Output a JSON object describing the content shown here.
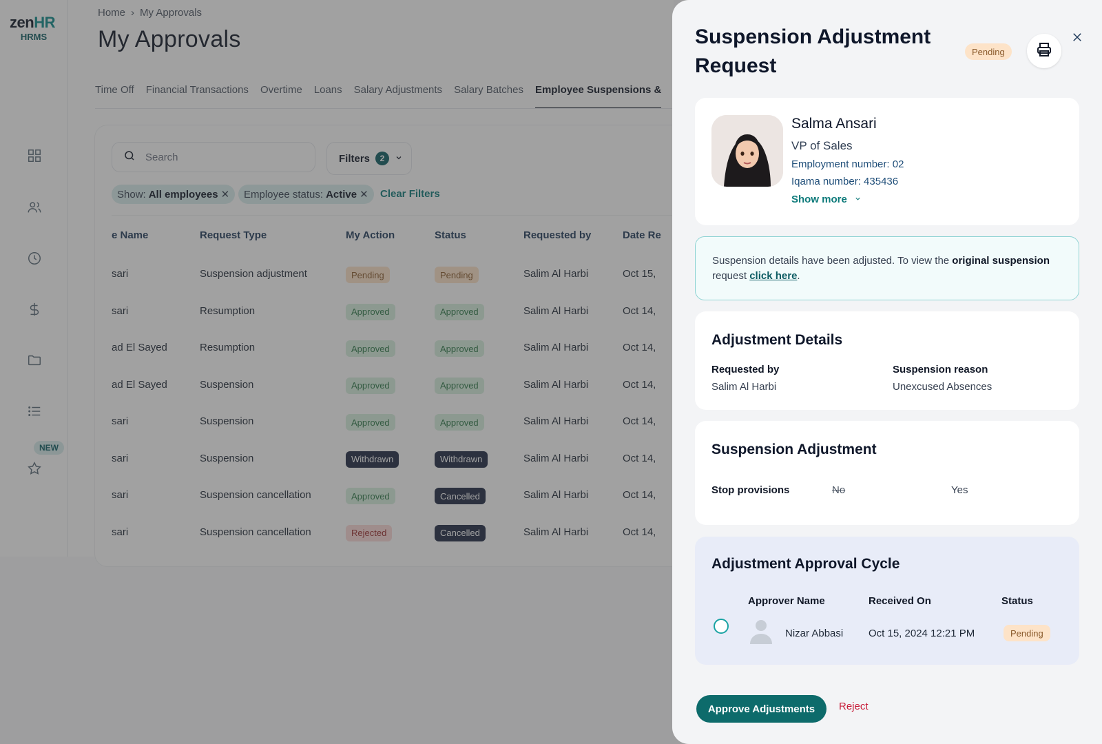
{
  "app": {
    "logo_main": "zen",
    "logo_accent": "HR",
    "logo_sub": "HRMS",
    "new_badge": "NEW"
  },
  "breadcrumb": {
    "home": "Home",
    "current": "My Approvals"
  },
  "page": {
    "title": "My Approvals"
  },
  "tabs": [
    "Time Off",
    "Financial Transactions",
    "Overtime",
    "Loans",
    "Salary Adjustments",
    "Salary Batches",
    "Employee Suspensions &"
  ],
  "active_tab_index": 6,
  "search": {
    "placeholder": "Search"
  },
  "filters": {
    "label": "Filters",
    "count": "2"
  },
  "chips": [
    {
      "prefix": "Show:",
      "value": "All employees"
    },
    {
      "prefix": "Employee status:",
      "value": "Active"
    }
  ],
  "clear_filters": "Clear Filters",
  "table": {
    "headers": [
      "e Name",
      "Request Type",
      "My Action",
      "Status",
      "Requested by",
      "Date Re"
    ],
    "rows": [
      {
        "name": "sari",
        "type": "Suspension adjustment",
        "action": "Pending",
        "action_kind": "pending",
        "status": "Pending",
        "status_kind": "pending",
        "by": "Salim Al Harbi",
        "date": "Oct 15,"
      },
      {
        "name": "sari",
        "type": "Resumption",
        "action": "Approved",
        "action_kind": "approved",
        "status": "Approved",
        "status_kind": "approved",
        "by": "Salim Al Harbi",
        "date": "Oct 14,"
      },
      {
        "name": "ad El Sayed",
        "type": "Resumption",
        "action": "Approved",
        "action_kind": "approved",
        "status": "Approved",
        "status_kind": "approved",
        "by": "Salim Al Harbi",
        "date": "Oct 14,"
      },
      {
        "name": "ad El Sayed",
        "type": "Suspension",
        "action": "Approved",
        "action_kind": "approved",
        "status": "Approved",
        "status_kind": "approved",
        "by": "Salim Al Harbi",
        "date": "Oct 14,"
      },
      {
        "name": "sari",
        "type": "Suspension",
        "action": "Approved",
        "action_kind": "approved",
        "status": "Approved",
        "status_kind": "approved",
        "by": "Salim Al Harbi",
        "date": "Oct 14,"
      },
      {
        "name": "sari",
        "type": "Suspension",
        "action": "Withdrawn",
        "action_kind": "withdrawn",
        "status": "Withdrawn",
        "status_kind": "withdrawn",
        "by": "Salim Al Harbi",
        "date": "Oct 14,"
      },
      {
        "name": "sari",
        "type": "Suspension cancellation",
        "action": "Approved",
        "action_kind": "approved",
        "status": "Cancelled",
        "status_kind": "cancelled",
        "by": "Salim Al Harbi",
        "date": "Oct 14,"
      },
      {
        "name": "sari",
        "type": "Suspension cancellation",
        "action": "Rejected",
        "action_kind": "rejected",
        "status": "Cancelled",
        "status_kind": "cancelled",
        "by": "Salim Al Harbi",
        "date": "Oct 14,"
      }
    ]
  },
  "drawer": {
    "title": "Suspension Adjustment Request",
    "status": "Pending",
    "employee": {
      "name": "Salma Ansari",
      "role": "VP of Sales",
      "employment_number": "Employment number: 02",
      "iqama_number": "Iqama number: 435436",
      "show_more": "Show more"
    },
    "notice": {
      "text_before": "Suspension details have been adjusted. To view the ",
      "bold": "original suspension",
      "text_mid": " request ",
      "link": "click here",
      "text_after": "."
    },
    "adjustment_details": {
      "title": "Adjustment Details",
      "requested_by_label": "Requested by",
      "requested_by": "Salim Al Harbi",
      "reason_label": "Suspension reason",
      "reason": "Unexcused Absences"
    },
    "suspension_adjustment": {
      "title": "Suspension Adjustment",
      "field_label": "Stop provisions",
      "old_value": "No",
      "new_value": "Yes"
    },
    "approval_cycle": {
      "title": "Adjustment Approval Cycle",
      "headers": {
        "approver": "Approver Name",
        "received": "Received On",
        "status": "Status"
      },
      "approver": "Nizar Abbasi",
      "received_on": "Oct 15, 2024 12:21 PM",
      "status": "Pending"
    },
    "actions": {
      "approve": "Approve Adjustments",
      "reject": "Reject"
    }
  },
  "colors": {
    "brand_teal": "#0d6b6b",
    "pending_bg": "#fde3c8",
    "approved_bg": "#d6f0de",
    "dark_pill_bg": "#1f2a44",
    "reject_red": "#c81e3a"
  }
}
